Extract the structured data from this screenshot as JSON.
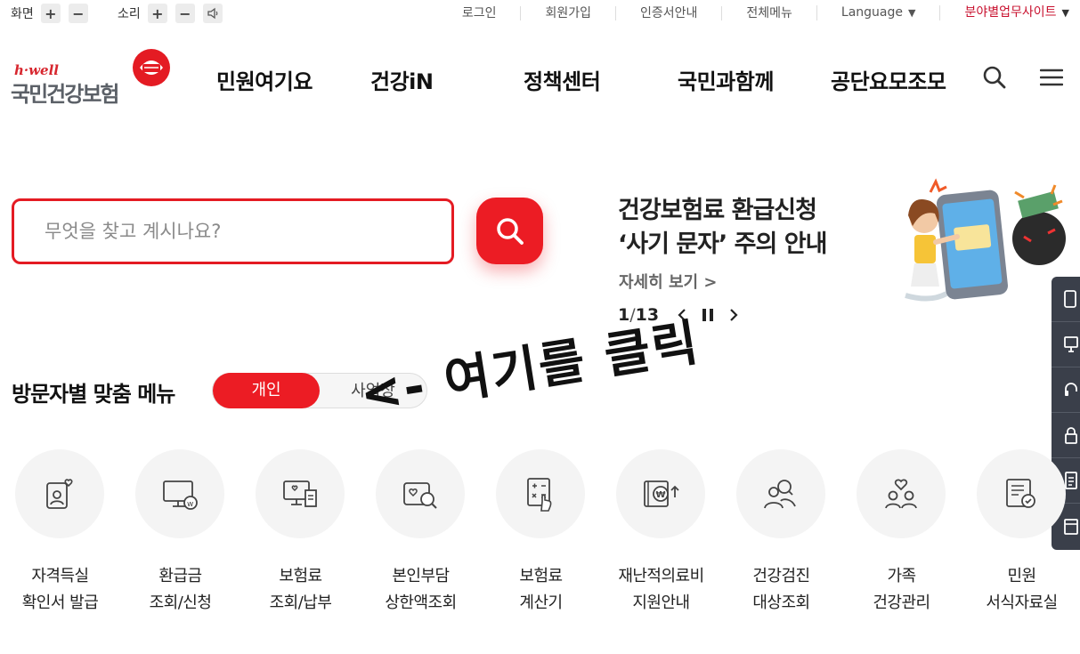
{
  "topbar": {
    "screen_label": "화면",
    "sound_label": "소리",
    "plus": "+",
    "minus": "−",
    "links": [
      {
        "label": "로그인"
      },
      {
        "label": "회원가입"
      },
      {
        "label": "인증서안내"
      },
      {
        "label": "전체메뉴"
      },
      {
        "label": "Language"
      },
      {
        "label": "분야별업무사이트"
      }
    ],
    "caret": "▼"
  },
  "logo": {
    "brand": "h·well",
    "name": "국민건강보험"
  },
  "nav": {
    "items": [
      {
        "label": "민원여기요"
      },
      {
        "label": "건강iN"
      },
      {
        "label": "정책센터"
      },
      {
        "label": "국민과함께"
      },
      {
        "label": "공단요모조모"
      }
    ]
  },
  "search": {
    "placeholder": "무엇을 찾고 계시나요?"
  },
  "banner": {
    "title_line1": "건강보험료 환급신청",
    "title_line2": "‘사기 문자’ 주의 안내",
    "more": "자세히 보기 >",
    "current": "1",
    "total": "13",
    "separator": " / "
  },
  "visitor": {
    "title": "방문자별 맞춤 메뉴",
    "tab_personal": "개인",
    "tab_business": "사업장"
  },
  "annotation": "<- 여기를 클릭",
  "menu": [
    {
      "line1": "자격득실",
      "line2": "확인서 발급",
      "icon": "id-card-heart-icon"
    },
    {
      "line1": "환급금",
      "line2": "조회/신청",
      "icon": "monitor-won-icon"
    },
    {
      "line1": "보험료",
      "line2": "조회/납부",
      "icon": "monitor-receipt-icon"
    },
    {
      "line1": "본인부담",
      "line2": "상한액조회",
      "icon": "heart-search-icon"
    },
    {
      "line1": "보험료",
      "line2": "계산기",
      "icon": "calculator-icon"
    },
    {
      "line1": "재난적의료비",
      "line2": "지원안내",
      "icon": "document-won-icon"
    },
    {
      "line1": "건강검진",
      "line2": "대상조회",
      "icon": "people-search-icon"
    },
    {
      "line1": "가족",
      "line2": "건강관리",
      "icon": "family-heart-icon"
    },
    {
      "line1": "민원",
      "line2": "서식자료실",
      "icon": "form-check-icon"
    }
  ],
  "colors": {
    "accent": "#ec1c24",
    "quickbar": "#3a3f4a"
  }
}
